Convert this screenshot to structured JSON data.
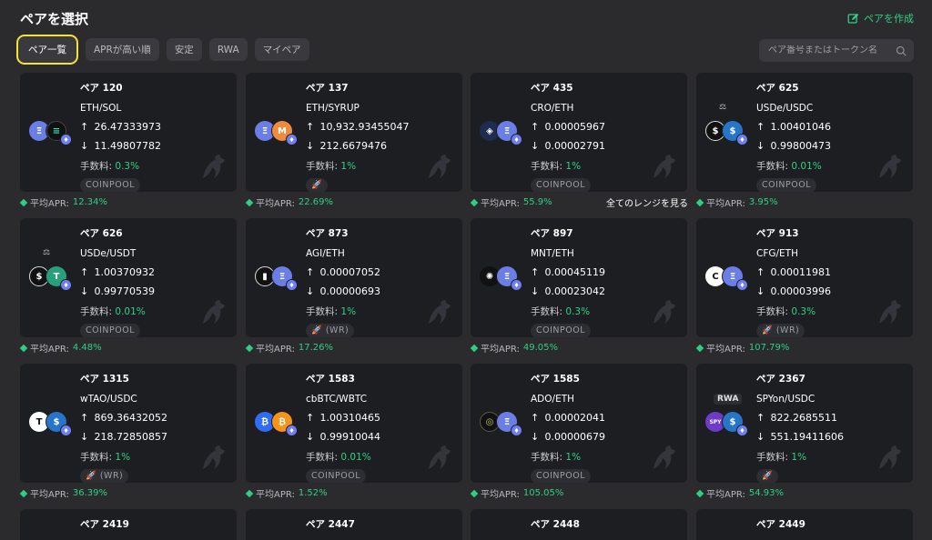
{
  "header": {
    "title": "ペアを選択",
    "create_label": "ペアを作成"
  },
  "filters": [
    "ペア一覧",
    "APRが高い順",
    "安定",
    "RWA",
    "マイペア"
  ],
  "search": {
    "placeholder": "ペア番号またはトークン名"
  },
  "apr_prefix": "平均APR: ",
  "range_link": "全てのレンジを見る",
  "fee_label": "手数料: ",
  "cards": [
    {
      "no": "ペア 120",
      "name": "ETH/SOL",
      "up": "26.47333973",
      "down": "11.49807782",
      "fee": "0.3%",
      "tag": "COINPOOL",
      "apr": "12.34%",
      "t1": "Ξ",
      "c1": "c-eth",
      "t2": "≡",
      "c2": "c-sol",
      "sub": ""
    },
    {
      "no": "ペア 137",
      "name": "ETH/SYRUP",
      "up": "10,932.93455047",
      "down": "212.6679476",
      "fee": "1%",
      "tag": "🚀",
      "apr": "22.69%",
      "t1": "Ξ",
      "c1": "c-eth",
      "t2": "M",
      "c2": "c-syrup",
      "sub": ""
    },
    {
      "no": "ペア 435",
      "name": "CRO/ETH",
      "up": "0.00005967",
      "down": "0.00002791",
      "fee": "1%",
      "tag": "COINPOOL",
      "apr": "55.9%",
      "t1": "◈",
      "c1": "c-cro",
      "t2": "Ξ",
      "c2": "c-eth",
      "sub": ""
    },
    {
      "no": "ペア 625",
      "name": "USDe/USDC",
      "up": "1.00401046",
      "down": "0.99800473",
      "fee": "0.01%",
      "tag": "COINPOOL",
      "apr": "3.95%",
      "t1": "$",
      "c1": "c-usde",
      "t2": "$",
      "c2": "c-usdc",
      "sub": "⚖"
    },
    {
      "no": "ペア 626",
      "name": "USDe/USDT",
      "up": "1.00370932",
      "down": "0.99770539",
      "fee": "0.01%",
      "tag": "COINPOOL",
      "apr": "4.48%",
      "t1": "$",
      "c1": "c-usde",
      "t2": "T",
      "c2": "c-usdt",
      "sub": "⚖"
    },
    {
      "no": "ペア 873",
      "name": "AGI/ETH",
      "up": "0.00007052",
      "down": "0.00000693",
      "fee": "1%",
      "tag": "🚀 (WR)",
      "apr": "17.26%",
      "t1": "▮",
      "c1": "c-agi",
      "t2": "Ξ",
      "c2": "c-eth",
      "sub": ""
    },
    {
      "no": "ペア 897",
      "name": "MNT/ETH",
      "up": "0.00045119",
      "down": "0.00023042",
      "fee": "0.3%",
      "tag": "COINPOOL",
      "apr": "49.05%",
      "t1": "✺",
      "c1": "c-mnt",
      "t2": "Ξ",
      "c2": "c-eth",
      "sub": ""
    },
    {
      "no": "ペア 913",
      "name": "CFG/ETH",
      "up": "0.00011981",
      "down": "0.00003996",
      "fee": "0.3%",
      "tag": "🚀 (WR)",
      "apr": "107.79%",
      "t1": "C",
      "c1": "c-cfg",
      "t2": "Ξ",
      "c2": "c-eth",
      "sub": ""
    },
    {
      "no": "ペア 1315",
      "name": "wTAO/USDC",
      "up": "869.36432052",
      "down": "218.72850857",
      "fee": "1%",
      "tag": "🚀 (WR)",
      "apr": "36.39%",
      "t1": "T",
      "c1": "c-tao",
      "t2": "$",
      "c2": "c-usdc",
      "sub": ""
    },
    {
      "no": "ペア 1583",
      "name": "cbBTC/WBTC",
      "up": "1.00310465",
      "down": "0.99910044",
      "fee": "0.01%",
      "tag": "COINPOOL",
      "apr": "1.52%",
      "t1": "₿",
      "c1": "c-cbbtc",
      "t2": "₿",
      "c2": "c-btc",
      "sub": ""
    },
    {
      "no": "ペア 1585",
      "name": "ADO/ETH",
      "up": "0.00002041",
      "down": "0.00000679",
      "fee": "1%",
      "tag": "COINPOOL",
      "apr": "105.05%",
      "t1": "◎",
      "c1": "c-ado",
      "t2": "Ξ",
      "c2": "c-eth",
      "sub": ""
    },
    {
      "no": "ペア 2367",
      "name": "SPYon/USDC",
      "up": "822.2685511",
      "down": "551.19411606",
      "fee": "1%",
      "tag": "🚀",
      "apr": "54.93%",
      "t1": "SPY",
      "c1": "c-spy",
      "t2": "$",
      "c2": "c-usdc",
      "sub": "RWA"
    }
  ],
  "next_row": [
    "ペア 2419",
    "ペア 2447",
    "ペア 2448",
    "ペア 2449"
  ]
}
